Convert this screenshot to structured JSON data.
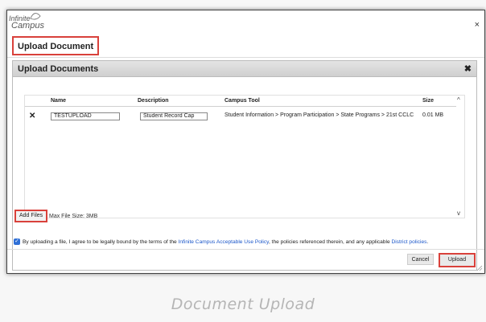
{
  "logo": {
    "line1": "Infinite",
    "line2": "Campus"
  },
  "window": {
    "close_icon": "×"
  },
  "page_title": "Upload Document",
  "dialog": {
    "title": "Upload Documents",
    "close_icon": "✖"
  },
  "grid": {
    "columns": [
      "Name",
      "Description",
      "Campus Tool",
      "Size"
    ],
    "rows": [
      {
        "remove_icon": "✕",
        "name": "TESTUPLOAD",
        "description": "Student Record Cap",
        "campus_tool": "Student Information > Program Participation > State Programs > 21st CCLC",
        "size": "0.01 MB"
      }
    ]
  },
  "scroll": {
    "up": "^",
    "down": "v"
  },
  "add_files_label": "Add Files",
  "max_file_size": "Max File Size: 3MB",
  "agreement": {
    "checked": true,
    "part1": "By uploading a file, I agree to be legally bound by the terms of the ",
    "link1": "Infinite Campus Acceptable Use Policy",
    "part2": ", the policies referenced therein, and any applicable ",
    "link2": "District policies",
    "part3": "."
  },
  "buttons": {
    "cancel": "Cancel",
    "upload": "Upload"
  },
  "caption": "Document Upload",
  "colors": {
    "highlight": "#d9413b",
    "link": "#1a56c9",
    "checkbox": "#2f6fd6"
  }
}
